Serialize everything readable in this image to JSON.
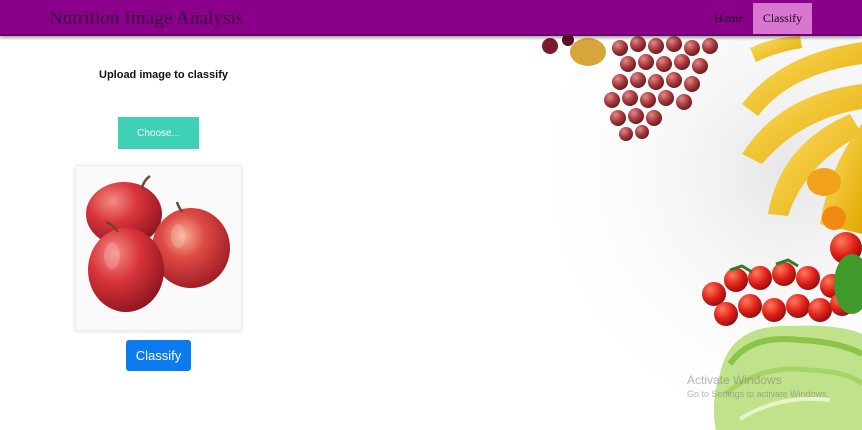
{
  "navbar": {
    "brand": "Nutrition Image Analysis",
    "items": [
      {
        "label": "Home"
      },
      {
        "label": "Classify",
        "active": true
      }
    ],
    "colors": {
      "bar": "#8b008b",
      "active_item": "#d977d0"
    }
  },
  "main": {
    "upload_title": "Upload image to classify",
    "choose_label": "Choose...",
    "preview_subject": "red apples",
    "classify_label": "Classify"
  },
  "decor": {
    "background_image": "fruits and vegetables (grapes, bananas, cherry tomatoes, lettuce)"
  },
  "watermark": {
    "title": "Activate Windows",
    "subtitle": "Go to Settings to activate Windows."
  },
  "colors": {
    "choose_button": "#3fd1b6",
    "classify_button": "#0d7bf0"
  }
}
